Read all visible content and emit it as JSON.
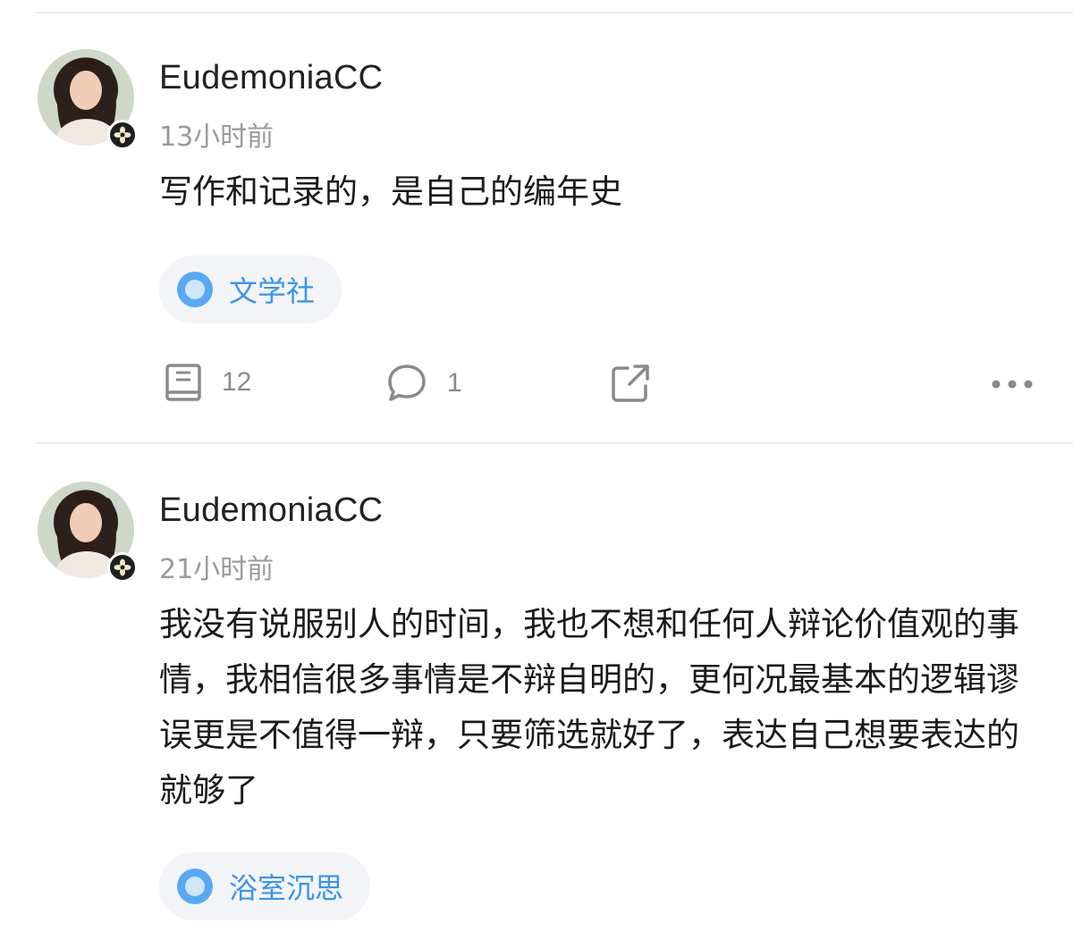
{
  "posts": [
    {
      "username": "EudemoniaCC",
      "time": "13小时前",
      "content": "写作和记录的，是自己的编年史",
      "tag": "文学社",
      "reads": "12",
      "comments": "1"
    },
    {
      "username": "EudemoniaCC",
      "time": "21小时前",
      "content": "我没有说服别人的时间，我也不想和任何人辩论价值观的事情，我相信很多事情是不辩自明的，更何况最基本的逻辑谬误更是不值得一辩，只要筛选就好了，表达自己想要表达的就够了",
      "tag": "浴室沉思"
    }
  ],
  "icons": {
    "badge": "flower-badge-icon",
    "tag": "circle-tag-icon",
    "reads": "book-icon",
    "comments": "comment-bubble-icon",
    "share": "share-icon",
    "more": "more-dots-icon"
  },
  "colors": {
    "tag_text": "#3b94e6",
    "tag_bg": "#f2f4f7",
    "meta_gray": "#9a9a9a"
  }
}
